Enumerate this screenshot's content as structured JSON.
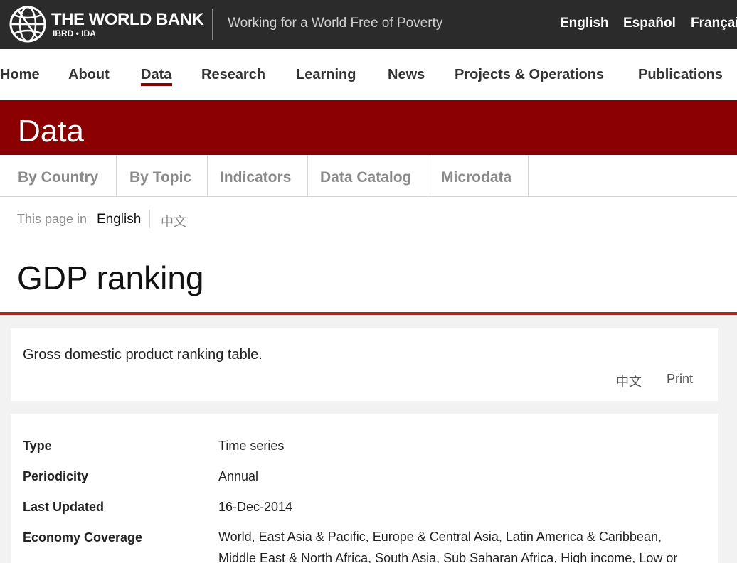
{
  "header": {
    "brand_title": "THE WORLD BANK",
    "brand_sub": "IBRD • IDA",
    "tagline": "Working for a World Free of Poverty",
    "languages": [
      "English",
      "Español",
      "Françai"
    ]
  },
  "main_nav": {
    "items": [
      "Home",
      "About",
      "Data",
      "Research",
      "Learning",
      "News",
      "Projects & Operations",
      "Publications"
    ],
    "active": "Data"
  },
  "banner": {
    "title": "Data"
  },
  "sub_nav": {
    "tabs": [
      "By Country",
      "By Topic",
      "Indicators",
      "Data Catalog",
      "Microdata"
    ]
  },
  "page_language": {
    "label": "This page in",
    "english": "English",
    "chinese": "中文"
  },
  "page": {
    "title": "GDP ranking"
  },
  "description_card": {
    "text": "Gross domestic product ranking table.",
    "chinese_link": "中文",
    "print_link": "Print"
  },
  "metadata": [
    {
      "key": "Type",
      "value": "Time series"
    },
    {
      "key": "Periodicity",
      "value": "Annual"
    },
    {
      "key": "Last Updated",
      "value": "16-Dec-2014"
    },
    {
      "key": "Economy Coverage",
      "value": "World, East Asia & Pacific, Europe & Central Asia, Latin America & Caribbean, Middle East & North Africa, South Asia, Sub Saharan Africa, High income, Low or"
    }
  ],
  "colors": {
    "topbar": "#2b2b2b",
    "brand_red": "#8b0000",
    "background": "#f2f2f2"
  }
}
